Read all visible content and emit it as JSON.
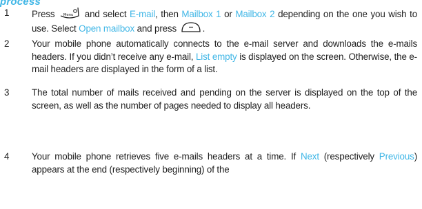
{
  "section": {
    "title": "process"
  },
  "steps": [
    {
      "number": "1",
      "parts": [
        "Press ",
        " and select ",
        "E-mail",
        ", then ",
        "Mailbox 1",
        " or ",
        "Mailbox 2",
        " depending on the one you wish to use. Select ",
        "Open mailbox",
        " and press ",
        "."
      ],
      "icons": {
        "menu_key": "menu-key-icon",
        "ok_key": "ok-key-icon",
        "menu_key_label": "Menu"
      }
    },
    {
      "number": "2",
      "parts": [
        "Your mobile phone automatically connects to the e-mail server and downloads the e-mails headers. If you didn’t receive any e-mail, ",
        "List empty",
        " is displayed on the screen. Otherwise, the e-mail headers are displayed in the form of a list."
      ]
    },
    {
      "number": "3",
      "parts": [
        "The total number of mails received and pending on the server is displayed on the top of the screen, as well as the number of pages needed to display all headers."
      ]
    },
    {
      "number": "4",
      "parts": [
        "Your mobile phone retrieves five e-mails headers at a time. If ",
        "Next",
        " (respectively ",
        "Previous",
        ") appears at the end (respectively beginning) of the"
      ]
    }
  ],
  "colors": {
    "highlight": "#3fb6e6",
    "text": "#1e1e1e"
  }
}
